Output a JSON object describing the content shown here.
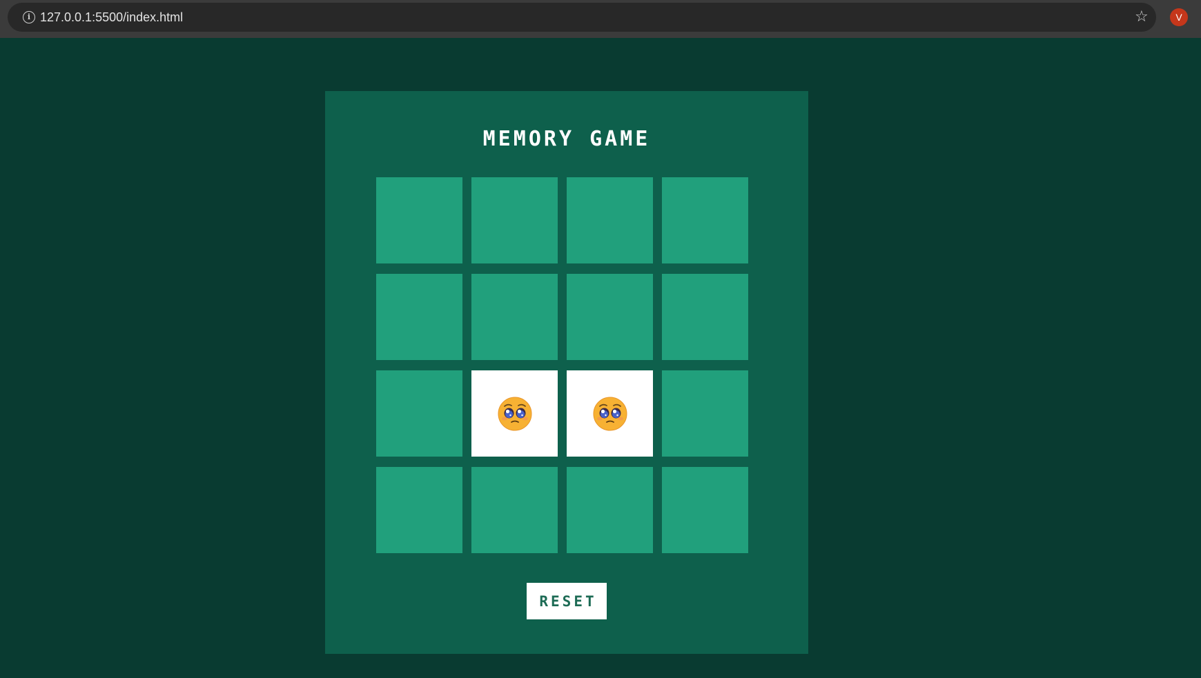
{
  "browser": {
    "url": "127.0.0.1:5500/index.html",
    "info_icon": "i",
    "bookmark_icon": "☆",
    "avatar_letter": "V"
  },
  "game": {
    "title": "MEMORY GAME",
    "reset_label": "RESET",
    "grid": {
      "rows": 4,
      "columns": 4
    },
    "cards": [
      {
        "flipped": false,
        "face": ""
      },
      {
        "flipped": false,
        "face": ""
      },
      {
        "flipped": false,
        "face": ""
      },
      {
        "flipped": false,
        "face": ""
      },
      {
        "flipped": false,
        "face": ""
      },
      {
        "flipped": false,
        "face": ""
      },
      {
        "flipped": false,
        "face": ""
      },
      {
        "flipped": false,
        "face": ""
      },
      {
        "flipped": false,
        "face": ""
      },
      {
        "flipped": true,
        "face": "pleading-face-emoji"
      },
      {
        "flipped": true,
        "face": "pleading-face-emoji"
      },
      {
        "flipped": false,
        "face": ""
      },
      {
        "flipped": false,
        "face": ""
      },
      {
        "flipped": false,
        "face": ""
      },
      {
        "flipped": false,
        "face": ""
      },
      {
        "flipped": false,
        "face": ""
      }
    ]
  },
  "colors": {
    "page_background": "#093b31",
    "panel_background": "#0e604c",
    "card_back": "#21a07c",
    "card_face": "#ffffff",
    "reset_text": "#1d6b55"
  }
}
